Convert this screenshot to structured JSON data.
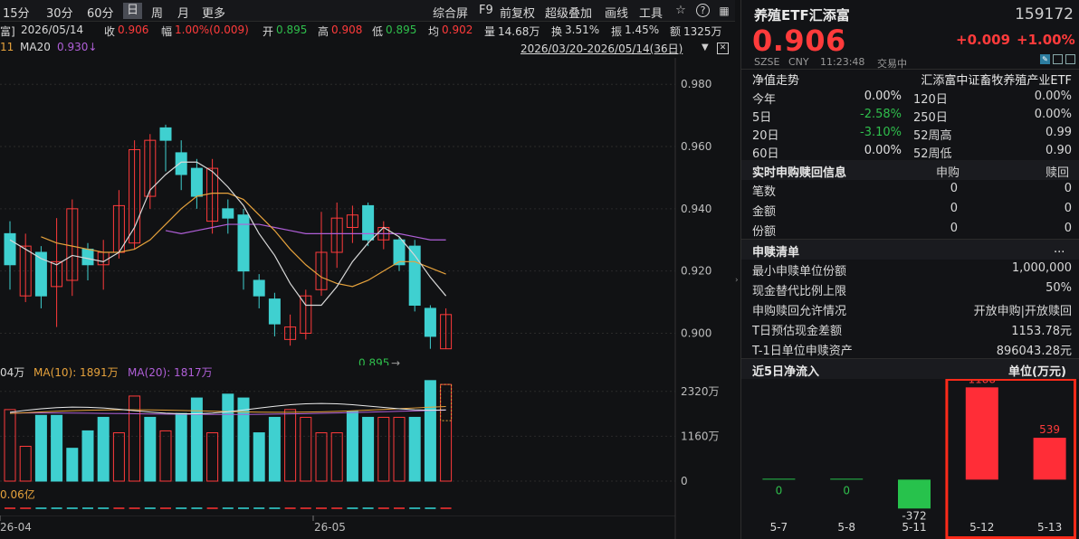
{
  "toolbar": {
    "periods": [
      "15分",
      "30分",
      "60分",
      "日",
      "周",
      "月",
      "更多"
    ],
    "active_period": "日",
    "tools": [
      "综合屏",
      "F9",
      "前复权",
      "超级叠加",
      "画线",
      "工具"
    ],
    "icons": [
      "favorite-icon",
      "help-icon",
      "grid-icon",
      "close-icon"
    ]
  },
  "info": {
    "prefix": "富]",
    "date": "2026/05/14",
    "close_label": "收",
    "close_value": "0.906",
    "change_label": "幅",
    "change_value": "1.00%(0.009)",
    "open_label": "开",
    "open_value": "0.895",
    "high_label": "高",
    "high_value": "0.908",
    "low_label": "低",
    "low_value": "0.895",
    "avg_label": "均",
    "avg_value": "0.902",
    "volume_label": "量",
    "volume_value": "14.68万",
    "turnover_label": "换",
    "turnover_value": "3.51%",
    "amplitude_label": "振",
    "amplitude_value": "1.45%",
    "amount_label": "额",
    "amount_value": "1325万"
  },
  "ma_row": {
    "ma_prefix": "11",
    "ma20_label": "MA20",
    "ma20_value": "0.930↓",
    "range": "2026/03/20-2026/05/14(36日)"
  },
  "colors": {
    "up": "#ff3b3b",
    "down": "#3fd0d0",
    "ma5": "#d8d8d8",
    "ma10": "#e6a23c",
    "ma20": "#b05fd8",
    "highlight": "#ff2a1a"
  },
  "chart_data": [
    {
      "type": "candlestick",
      "y_ticks": [
        "0.980",
        "0.960",
        "0.940",
        "0.920",
        "0.900"
      ],
      "ylim": [
        0.892,
        0.985
      ],
      "last_price_label": "0.895",
      "candles": [
        {
          "open": 0.932,
          "close": 0.922,
          "high": 0.936,
          "low": 0.914
        },
        {
          "open": 0.912,
          "close": 0.928,
          "high": 0.932,
          "low": 0.91
        },
        {
          "open": 0.926,
          "close": 0.912,
          "high": 0.928,
          "low": 0.908
        },
        {
          "open": 0.915,
          "close": 0.923,
          "high": 0.937,
          "low": 0.902
        },
        {
          "open": 0.917,
          "close": 0.94,
          "high": 0.943,
          "low": 0.912
        },
        {
          "open": 0.927,
          "close": 0.922,
          "high": 0.929,
          "low": 0.917
        },
        {
          "open": 0.922,
          "close": 0.926,
          "high": 0.93,
          "low": 0.914
        },
        {
          "open": 0.926,
          "close": 0.941,
          "high": 0.946,
          "low": 0.924
        },
        {
          "open": 0.929,
          "close": 0.959,
          "high": 0.962,
          "low": 0.927
        },
        {
          "open": 0.944,
          "close": 0.962,
          "high": 0.964,
          "low": 0.94
        },
        {
          "open": 0.966,
          "close": 0.962,
          "high": 0.967,
          "low": 0.952
        },
        {
          "open": 0.958,
          "close": 0.951,
          "high": 0.962,
          "low": 0.946
        },
        {
          "open": 0.953,
          "close": 0.944,
          "high": 0.956,
          "low": 0.94
        },
        {
          "open": 0.936,
          "close": 0.953,
          "high": 0.956,
          "low": 0.932
        },
        {
          "open": 0.94,
          "close": 0.937,
          "high": 0.943,
          "low": 0.932
        },
        {
          "open": 0.938,
          "close": 0.92,
          "high": 0.94,
          "low": 0.914
        },
        {
          "open": 0.917,
          "close": 0.912,
          "high": 0.919,
          "low": 0.908
        },
        {
          "open": 0.911,
          "close": 0.903,
          "high": 0.913,
          "low": 0.899
        },
        {
          "open": 0.898,
          "close": 0.902,
          "high": 0.906,
          "low": 0.896
        },
        {
          "open": 0.9,
          "close": 0.912,
          "high": 0.914,
          "low": 0.898
        },
        {
          "open": 0.914,
          "close": 0.926,
          "high": 0.939,
          "low": 0.912
        },
        {
          "open": 0.926,
          "close": 0.937,
          "high": 0.942,
          "low": 0.921
        },
        {
          "open": 0.934,
          "close": 0.938,
          "high": 0.941,
          "low": 0.929
        },
        {
          "open": 0.941,
          "close": 0.93,
          "high": 0.942,
          "low": 0.928
        },
        {
          "open": 0.93,
          "close": 0.934,
          "high": 0.936,
          "low": 0.927
        },
        {
          "open": 0.93,
          "close": 0.922,
          "high": 0.931,
          "low": 0.92
        },
        {
          "open": 0.928,
          "close": 0.909,
          "high": 0.93,
          "low": 0.907
        },
        {
          "open": 0.908,
          "close": 0.899,
          "high": 0.909,
          "low": 0.895
        },
        {
          "open": 0.895,
          "close": 0.906,
          "high": 0.908,
          "low": 0.895
        }
      ],
      "ma5": [
        0.93,
        0.927,
        0.924,
        0.922,
        0.925,
        0.924,
        0.923,
        0.926,
        0.934,
        0.946,
        0.951,
        0.955,
        0.955,
        0.952,
        0.947,
        0.941,
        0.932,
        0.925,
        0.916,
        0.909,
        0.909,
        0.915,
        0.923,
        0.929,
        0.934,
        0.931,
        0.925,
        0.918,
        0.912
      ],
      "ma10": [
        null,
        null,
        0.931,
        0.929,
        0.928,
        0.927,
        0.926,
        0.926,
        0.927,
        0.93,
        0.935,
        0.94,
        0.944,
        0.945,
        0.945,
        0.943,
        0.938,
        0.933,
        0.927,
        0.922,
        0.918,
        0.916,
        0.915,
        0.917,
        0.92,
        0.923,
        0.923,
        0.921,
        0.919
      ],
      "ma20": [
        null,
        null,
        null,
        null,
        null,
        null,
        null,
        null,
        null,
        null,
        0.933,
        0.932,
        0.933,
        0.934,
        0.935,
        0.935,
        0.935,
        0.934,
        0.933,
        0.932,
        0.932,
        0.932,
        0.932,
        0.932,
        0.932,
        0.932,
        0.931,
        0.93,
        0.93
      ]
    },
    {
      "type": "bar",
      "legend": {
        "ma5_label": "04万",
        "ma10_label": "MA(10): 1891万",
        "ma20_label": "MA(20): 1817万"
      },
      "y_ticks": [
        "2320万",
        "1160万",
        "0"
      ],
      "ylim": [
        0,
        2900
      ],
      "values": [
        1850,
        900,
        1700,
        1700,
        850,
        1300,
        1650,
        1250,
        2200,
        1650,
        1300,
        1750,
        2150,
        1250,
        2250,
        2150,
        1250,
        1650,
        1850,
        1650,
        1250,
        1250,
        1800,
        1650,
        1650,
        1650,
        1650,
        2600,
        2500
      ],
      "up": [
        true,
        true,
        false,
        false,
        false,
        false,
        false,
        true,
        true,
        false,
        true,
        false,
        false,
        true,
        false,
        false,
        false,
        false,
        true,
        true,
        true,
        true,
        false,
        false,
        true,
        true,
        false,
        false,
        true
      ],
      "x_ticks": [
        "26-04",
        "26-05"
      ],
      "flow_label": "0.06亿"
    },
    {
      "type": "bar",
      "title": "近5日净流入",
      "unit": "单位(万元)",
      "categories": [
        "5-7",
        "5-8",
        "5-11",
        "5-12",
        "5-13"
      ],
      "values": [
        0,
        0,
        -372,
        1188,
        539
      ],
      "labels": [
        "0",
        "0",
        "-372",
        "1188",
        "539"
      ],
      "ylim": [
        -450,
        1250
      ]
    }
  ],
  "panel": {
    "name": "养殖ETF汇添富",
    "code": "159172",
    "price": "0.906",
    "change": "+0.009",
    "change_pct": "+1.00%",
    "market": "SZSE",
    "currency": "CNY",
    "time": "11:23:48",
    "status": "交易中",
    "nav_title": "净值走势",
    "fund_name": "汇添富中证畜牧养殖产业ETF",
    "nav_rows": [
      {
        "l1": "今年",
        "v1": "0.00%",
        "c1": "none",
        "l2": "120日",
        "v2": "0.00%"
      },
      {
        "l1": "5日",
        "v1": "-2.58%",
        "c1": "green",
        "l2": "250日",
        "v2": "0.00%"
      },
      {
        "l1": "20日",
        "v1": "-3.10%",
        "c1": "green",
        "l2": "52周高",
        "v2": "0.99"
      },
      {
        "l1": "60日",
        "v1": "0.00%",
        "c1": "none",
        "l2": "52周低",
        "v2": "0.90"
      }
    ],
    "rt_title": "实时申购赎回信息",
    "rt_col1": "申购",
    "rt_col2": "赎回",
    "rt_rows": [
      {
        "label": "笔数",
        "a": "0",
        "b": "0"
      },
      {
        "label": "金额",
        "a": "0",
        "b": "0"
      },
      {
        "label": "份额",
        "a": "0",
        "b": "0"
      }
    ],
    "list_title": "申赎清单",
    "list_more": "...",
    "list_rows": [
      {
        "label": "最小申赎单位份额",
        "value": "1,000,000"
      },
      {
        "label": "现金替代比例上限",
        "value": "50%"
      },
      {
        "label": "申购赎回允许情况",
        "value": "开放申购|开放赎回"
      },
      {
        "label": "T日预估现金差额",
        "value": "1153.78元"
      },
      {
        "label": "T-1日单位申赎资产",
        "value": "896043.28元"
      }
    ]
  }
}
